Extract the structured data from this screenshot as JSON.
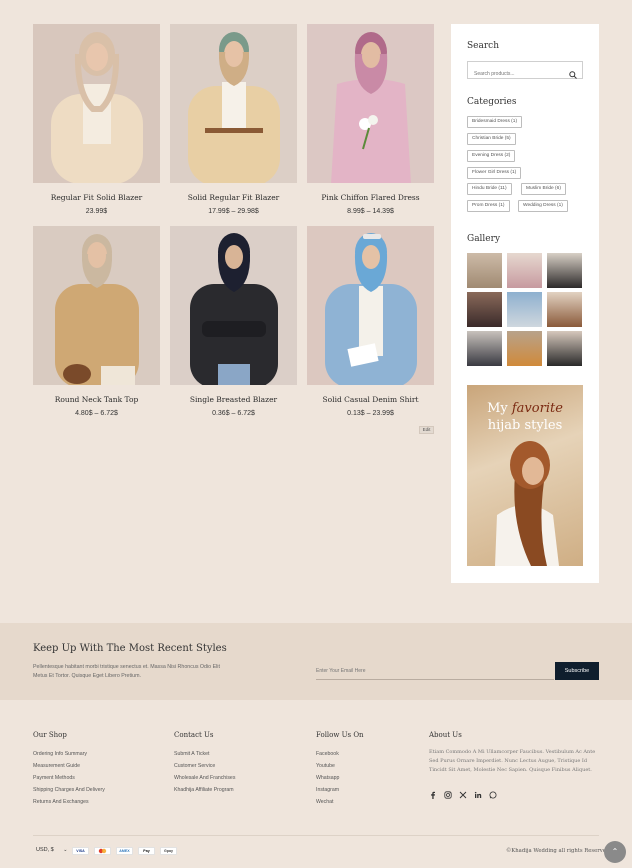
{
  "products": [
    {
      "name": "Regular Fit Solid Blazer",
      "price": "23.99$"
    },
    {
      "name": "Solid Regular Fit Blazer",
      "price": "17.99$ – 29.98$"
    },
    {
      "name": "Pink Chiffon Flared Dress",
      "price": "8.99$ – 14.39$"
    },
    {
      "name": "Round Neck Tank Top",
      "price": "4.80$ – 6.72$"
    },
    {
      "name": "Single Breasted Blazer",
      "price": "0.36$ – 6.72$"
    },
    {
      "name": "Solid Casual Denim Shirt",
      "price": "0.13$ – 23.99$"
    }
  ],
  "edit_label": "Edit",
  "sidebar": {
    "search_title": "Search",
    "search_placeholder": "Search products...",
    "categories_title": "Categories",
    "categories": [
      "Bridesmaid Dress (1)",
      "Christian Bride (5)",
      "Evening Dress (2)",
      "Flower Girl Dress (1)",
      "Hindu Bride (11)",
      "Muslim Bride (6)",
      "Prom Dress (1)",
      "Wedding Dress (1)"
    ],
    "gallery_title": "Gallery",
    "promo_line1_a": "My ",
    "promo_line1_b": "favorite",
    "promo_line2": "hijab styles"
  },
  "newsletter": {
    "title": "Keep Up With The Most Recent Styles",
    "description": "Pellentesque habitant morbi tristique senectus et. Massa Nisi Rhoncus Odio Elit Metus Et Tortor. Quisque Eget Libero Pretium.",
    "email_placeholder": "Enter Your Email Here",
    "button": "Subscribe"
  },
  "footer": {
    "our_shop": {
      "title": "Our Shop",
      "links": [
        "Ordering Info Summary",
        "Measurement Guide",
        "Payment Methods",
        "Shipping Charges And Delivery",
        "Returns And Exchanges"
      ]
    },
    "contact_us": {
      "title": "Contact Us",
      "links": [
        "Submit A Ticket",
        "Customer Service",
        "Wholesale And Franchises",
        "Khadhija Affiliate Program"
      ]
    },
    "follow_us": {
      "title": "Follow Us On",
      "links": [
        "Facebook",
        "Youtube",
        "Whatsapp",
        "Instagram",
        "Wechat"
      ]
    },
    "about": {
      "title": "About Us",
      "text": "Etiam Commodo A Mi Ullamcorper Faucibus. Vestibulum Ac Ante Sed Purus Ornare Imperdiet. Nunc Lectus Augue, Tristique Id Tincidt Sit Amet, Molestie Nec Sapien. Quisque Finibus Aliquet."
    },
    "social_icons": [
      "facebook-icon",
      "instagram-icon",
      "x-icon",
      "linkedin-icon",
      "whatsapp-icon"
    ],
    "currency": "USD, $",
    "payments": [
      "VISA",
      "MC",
      "AMEX",
      "Pay",
      "Gpay"
    ],
    "copyright": "©Khadija Wedding all rights Reserved"
  },
  "colors": {
    "background": "#efe5dc",
    "newsletter_bg": "#e6d9cc",
    "button": "#0f1e2d"
  }
}
